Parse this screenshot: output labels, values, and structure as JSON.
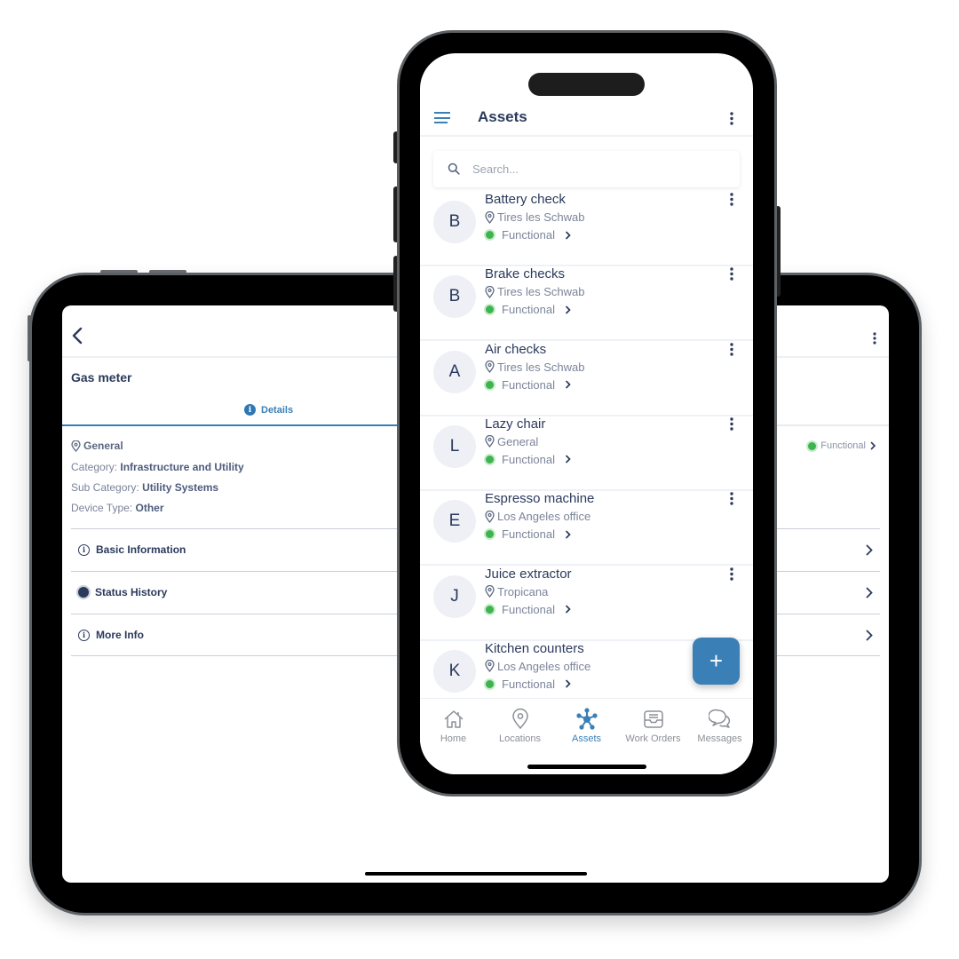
{
  "tablet": {
    "asset_title": "Gas meter",
    "tabs": [
      {
        "label": "Details",
        "icon": "info-icon",
        "active": true
      }
    ],
    "general": {
      "location": "General",
      "category_label": "Category:",
      "category_value": "Infrastructure and Utility",
      "subcategory_label": "Sub Category:",
      "subcategory_value": "Utility Systems",
      "device_type_label": "Device Type:",
      "device_type_value": "Other",
      "status": "Functional"
    },
    "sections": [
      {
        "label": "Basic Information",
        "icon": "info-circle-icon"
      },
      {
        "label": "Status History",
        "icon": "radio-dot-icon"
      },
      {
        "label": "More Info",
        "icon": "info-circle-icon"
      }
    ]
  },
  "phone": {
    "title": "Assets",
    "search": {
      "placeholder": "Search..."
    },
    "assets": [
      {
        "initial": "B",
        "name": "Battery check",
        "location": "Tires les Schwab",
        "status": "Functional"
      },
      {
        "initial": "B",
        "name": "Brake checks",
        "location": "Tires les Schwab",
        "status": "Functional"
      },
      {
        "initial": "A",
        "name": "Air checks",
        "location": "Tires les Schwab",
        "status": "Functional"
      },
      {
        "initial": "L",
        "name": "Lazy chair",
        "location": "General",
        "status": "Functional"
      },
      {
        "initial": "E",
        "name": "Espresso machine",
        "location": "Los Angeles office",
        "status": "Functional"
      },
      {
        "initial": "J",
        "name": "Juice extractor",
        "location": "Tropicana",
        "status": "Functional"
      },
      {
        "initial": "K",
        "name": "Kitchen  counters",
        "location": "Los Angeles office",
        "status": "Functional"
      }
    ],
    "fab_label": "+",
    "nav": [
      {
        "label": "Home",
        "icon": "home-icon",
        "active": false
      },
      {
        "label": "Locations",
        "icon": "location-pin-icon",
        "active": false
      },
      {
        "label": "Assets",
        "icon": "assets-network-icon",
        "active": true
      },
      {
        "label": "Work Orders",
        "icon": "inbox-tray-icon",
        "active": false
      },
      {
        "label": "Messages",
        "icon": "chat-bubbles-icon",
        "active": false
      }
    ]
  },
  "colors": {
    "accent": "#3a7fb6",
    "text_primary": "#2b3a5c",
    "text_secondary": "#7b849a",
    "status_functional": "#3fb34f"
  }
}
